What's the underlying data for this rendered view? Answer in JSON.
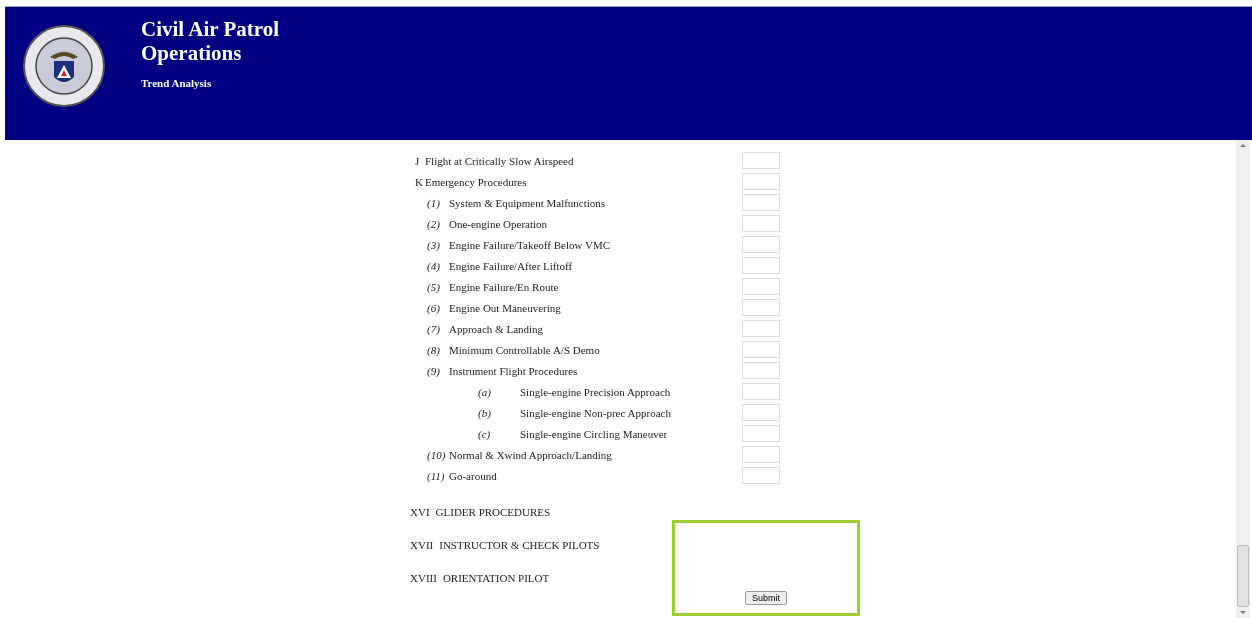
{
  "header": {
    "title_line_1": "Civil Air Patrol",
    "title_line_2": "Operations",
    "subtitle": "Trend Analysis"
  },
  "items": [
    {
      "marker": "J",
      "label": "Flight at Critically Slow Airspeed"
    },
    {
      "marker": "K",
      "label": "Emergency Procedures",
      "children": [
        {
          "marker": "(1)",
          "label": "System & Equipment Malfunctions"
        },
        {
          "marker": "(2)",
          "label": "One-engine Operation"
        },
        {
          "marker": "(3)",
          "label": "Engine Failure/Takeoff Below VMC"
        },
        {
          "marker": "(4)",
          "label": "Engine Failure/After Liftoff"
        },
        {
          "marker": "(5)",
          "label": "Engine Failure/En Route"
        },
        {
          "marker": "(6)",
          "label": "Engine Out Maneuvering"
        },
        {
          "marker": "(7)",
          "label": "Approach & Landing"
        },
        {
          "marker": "(8)",
          "label": "Minimum Controllable A/S Demo"
        },
        {
          "marker": "(9)",
          "label": "Instrument Flight Procedures",
          "children": [
            {
              "marker": "(a)",
              "label": "Single-engine Precision Approach"
            },
            {
              "marker": "(b)",
              "label": "Single-engine Non-prec Approach"
            },
            {
              "marker": "(c)",
              "label": "Single-engine Circling Maneuver"
            }
          ]
        },
        {
          "marker": "(10)",
          "label": "Normal & Xwind Approach/Landing"
        },
        {
          "marker": "(11)",
          "label": "Go-around"
        }
      ]
    }
  ],
  "sections": [
    {
      "numeral": "XVI",
      "title": "GLIDER PROCEDURES"
    },
    {
      "numeral": "XVII",
      "title": "INSTRUCTOR & CHECK PILOTS"
    },
    {
      "numeral": "XVIII",
      "title": "ORIENTATION PILOT"
    }
  ],
  "submit_button": "Submit"
}
